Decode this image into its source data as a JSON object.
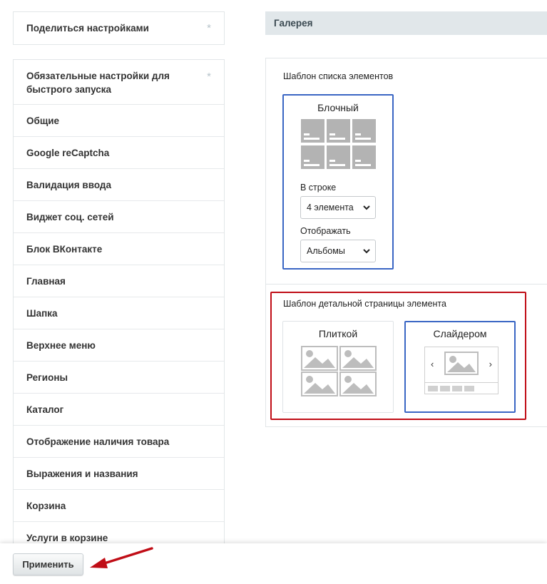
{
  "sidebar": {
    "share": {
      "label": "Поделиться настройками",
      "mark": "*"
    },
    "items": [
      {
        "label": "Обязательные настройки для быстрого запуска",
        "mark": "*"
      },
      {
        "label": "Общие"
      },
      {
        "label": "Google reCaptcha"
      },
      {
        "label": "Валидация ввода"
      },
      {
        "label": "Виджет соц. сетей"
      },
      {
        "label": "Блок ВКонтакте"
      },
      {
        "label": "Главная"
      },
      {
        "label": "Шапка"
      },
      {
        "label": "Верхнее меню"
      },
      {
        "label": "Регионы"
      },
      {
        "label": "Каталог"
      },
      {
        "label": "Отображение наличия товара"
      },
      {
        "label": "Выражения и названия"
      },
      {
        "label": "Корзина"
      },
      {
        "label": "Услуги в корзине"
      }
    ]
  },
  "main": {
    "section_title": "Галерея",
    "list_template": {
      "label": "Шаблон списка элементов",
      "option": {
        "title": "Блочный",
        "selected": true,
        "per_row_label": "В строке",
        "per_row_value": "4 элемента",
        "display_label": "Отображать",
        "display_value": "Альбомы"
      }
    },
    "detail_template": {
      "label": "Шаблон детальной страницы элемента",
      "options": [
        {
          "title": "Плиткой",
          "selected": false
        },
        {
          "title": "Слайдером",
          "selected": true
        }
      ],
      "slider_prev": "‹",
      "slider_next": "›"
    }
  },
  "footer": {
    "apply_label": "Применить"
  },
  "colors": {
    "selected_border": "#3a66c4",
    "highlight_annotation": "#c00d16",
    "annotation_arrow": "#c00d16",
    "header_bg": "#e1e7ea"
  },
  "icons": [
    "star-icon",
    "chevron-down-icon",
    "image-placeholder-icon",
    "annotation-arrow-icon"
  ]
}
